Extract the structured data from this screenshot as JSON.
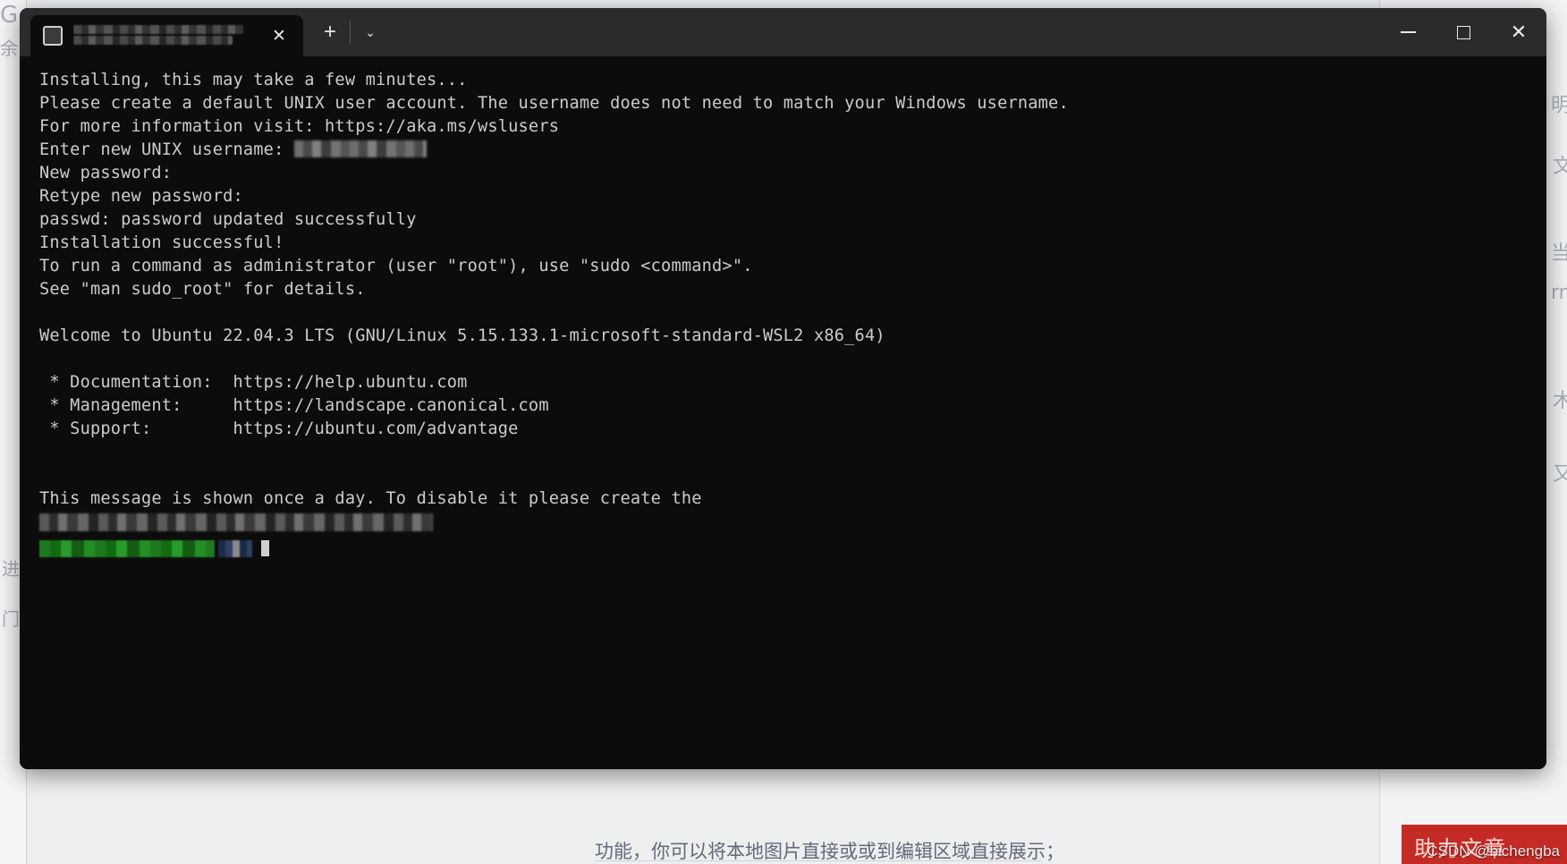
{
  "window": {
    "app": "Windows Terminal",
    "tab_title_redacted": true,
    "tab_close_glyph": "✕",
    "new_tab_glyph": "+",
    "dropdown_glyph": "⌄",
    "minimize_label": "Minimize",
    "maximize_label": "Maximize",
    "close_label": "Close",
    "close_glyph": "✕"
  },
  "terminal": {
    "lines": [
      {
        "text": "Installing, this may take a few minutes...",
        "type": "text"
      },
      {
        "text": "Please create a default UNIX user account. The username does not need to match your Windows username.",
        "type": "text"
      },
      {
        "text": "For more information visit: https://aka.ms/wslusers",
        "type": "text"
      },
      {
        "text": "Enter new UNIX username: ",
        "type": "redacted-inline",
        "redact_width": 148
      },
      {
        "text": "New password:",
        "type": "text"
      },
      {
        "text": "Retype new password:",
        "type": "text"
      },
      {
        "text": "passwd: password updated successfully",
        "type": "text"
      },
      {
        "text": "Installation successful!",
        "type": "text"
      },
      {
        "text": "To run a command as administrator (user \"root\"), use \"sudo <command>\".",
        "type": "text"
      },
      {
        "text": "See \"man sudo_root\" for details.",
        "type": "text"
      },
      {
        "text": "",
        "type": "blank"
      },
      {
        "text": "Welcome to Ubuntu 22.04.3 LTS (GNU/Linux 5.15.133.1-microsoft-standard-WSL2 x86_64)",
        "type": "text"
      },
      {
        "text": "",
        "type": "blank"
      },
      {
        "text": " * Documentation:  https://help.ubuntu.com",
        "type": "text"
      },
      {
        "text": " * Management:     https://landscape.canonical.com",
        "type": "text"
      },
      {
        "text": " * Support:        https://ubuntu.com/advantage",
        "type": "text"
      },
      {
        "text": "",
        "type": "blank"
      },
      {
        "text": "",
        "type": "blank"
      },
      {
        "text": "This message is shown once a day. To disable it please create the",
        "type": "text"
      },
      {
        "text": "",
        "type": "redacted-block"
      },
      {
        "text": "",
        "type": "prompt-redacted"
      }
    ]
  },
  "watermark": {
    "text": "CSDN @bichengba"
  },
  "background": {
    "note_fragment": "功能，你可以将本地图片直接或或到编辑区域直接展示；",
    "badge_text": "助力文章",
    "side_glyphs": [
      "G",
      "余",
      "进",
      "门",
      "才",
      "又",
      "Ⅱ"
    ]
  },
  "colors": {
    "terminal_bg": "#0c0c0c",
    "titlebar_bg": "#2b2b2b",
    "terminal_fg": "#cccccc",
    "prompt_green": "#1f9b1f",
    "accent_red": "#c42b25"
  }
}
